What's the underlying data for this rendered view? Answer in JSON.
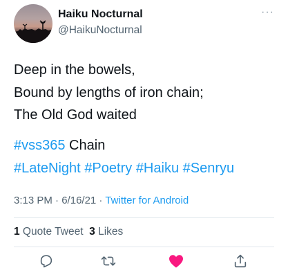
{
  "tweet": {
    "author": {
      "name": "Haiku Nocturnal",
      "handle": "@HaikuNocturnal"
    },
    "text": {
      "line1": "Deep in the bowels,",
      "line2": "Bound by lengths of iron chain;",
      "line3": "The Old God waited",
      "hashtags_line1": [
        {
          "tag": "#vss365",
          "suffix": " Chain"
        }
      ],
      "hashtags_line2": [
        "#LateNight",
        "#Poetry",
        "#Haiku",
        "#Senryu"
      ]
    },
    "meta": {
      "time": "3:13 PM",
      "separator": " · ",
      "date": "6/16/21",
      "source": "Twitter for Android"
    },
    "stats": {
      "quote_count": "1",
      "quote_label": " Quote Tweet",
      "like_count": "3",
      "like_label": " Likes"
    },
    "actions": {
      "reply_icon": "reply-icon",
      "retweet_icon": "retweet-icon",
      "like_icon": "heart-icon",
      "share_icon": "share-icon",
      "liked": true
    },
    "colors": {
      "accent": "#1d9bf0",
      "like": "#f91880",
      "secondary_text": "#536471",
      "primary_text": "#0f1419"
    }
  }
}
